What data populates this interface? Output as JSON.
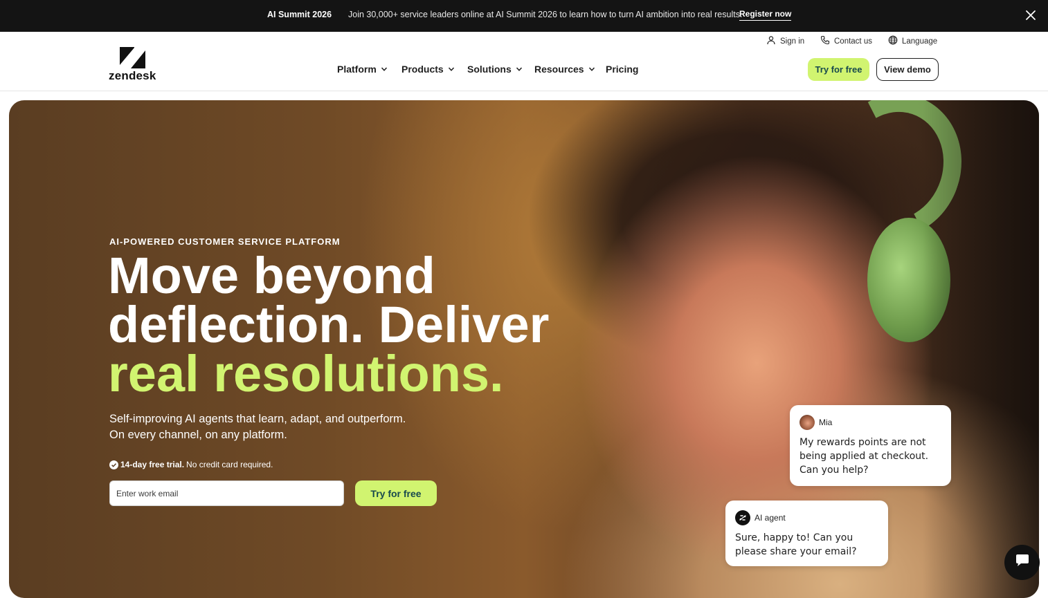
{
  "announcement": {
    "title": "AI Summit 2026",
    "message": "Join 30,000+ service leaders online at AI Summit 2026 to learn how to turn AI ambition into real results.",
    "cta": "Register now"
  },
  "header": {
    "logo_text": "zendesk",
    "utility": {
      "sign_in": "Sign in",
      "contact": "Contact us",
      "language": "Language"
    },
    "nav": [
      {
        "label": "Platform"
      },
      {
        "label": "Products"
      },
      {
        "label": "Solutions"
      },
      {
        "label": "Resources"
      },
      {
        "label": "Pricing"
      }
    ],
    "try_free": "Try for free",
    "view_demo": "View demo"
  },
  "hero": {
    "eyebrow": "AI-POWERED CUSTOMER SERVICE PLATFORM",
    "headline": {
      "line1": "Move beyond",
      "line2": "deflection. Deliver",
      "line3": "real resolutions."
    },
    "subhead": {
      "line1": "Self-improving AI agents that learn, adapt, and outperform.",
      "line2": "On every channel, on any platform."
    },
    "trial_bold": "14-day free trial.",
    "trial_rest": "No credit card required.",
    "email_placeholder": "Enter work email",
    "cta": "Try for free"
  },
  "chat": {
    "customer": {
      "name": "Mia",
      "message": "My rewards points are not being applied at checkout. Can you help?"
    },
    "agent": {
      "name": "AI agent",
      "message": "Sure, happy to! Can you please share your email?"
    }
  },
  "colors": {
    "accent_lime": "#d1f470",
    "dark_teal": "#17494d",
    "announce_bg": "#141414"
  }
}
